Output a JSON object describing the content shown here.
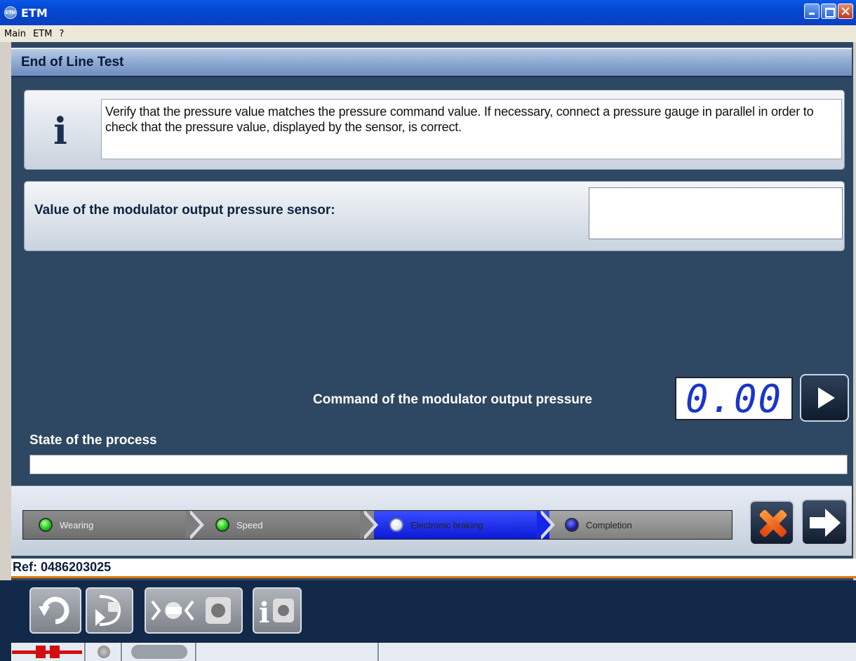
{
  "window": {
    "title": "ETM",
    "app_icon_text": "ETM"
  },
  "menu": {
    "items": [
      "Main",
      "ETM",
      "?"
    ]
  },
  "page": {
    "title": "End of Line Test"
  },
  "info": {
    "text": "Verify that the pressure value matches the pressure command value. If necessary, connect a pressure gauge in parallel in order to check that the pressure value, displayed by the sensor, is correct."
  },
  "sensor": {
    "label": "Value of the modulator output pressure sensor:",
    "value": ""
  },
  "command": {
    "label": "Command of the modulator output pressure",
    "display": "0.00"
  },
  "process": {
    "label": "State of the process",
    "progress": 0
  },
  "steps": [
    {
      "label": "Wearing",
      "state": "done",
      "color": "#1ecf1e"
    },
    {
      "label": "Speed",
      "state": "done",
      "color": "#1ecf1e"
    },
    {
      "label": "Electronic braking",
      "state": "current",
      "color": "#ffffff"
    },
    {
      "label": "Completion",
      "state": "pending",
      "color": "#1a1aa8"
    }
  ],
  "ref": {
    "text": "Ref: 0486203025"
  },
  "toolbar": {
    "buttons": [
      "undo-icon",
      "connect-icon",
      "ecu-link-icon",
      "ecu-info-icon"
    ]
  },
  "statusbar": {
    "icons": [
      "plug-connected-icon",
      "led-icon",
      "usb-icon"
    ]
  },
  "colors": {
    "accent": "#0b1ad6",
    "background": "#2e4762",
    "ref_underline": "#e07a10"
  }
}
